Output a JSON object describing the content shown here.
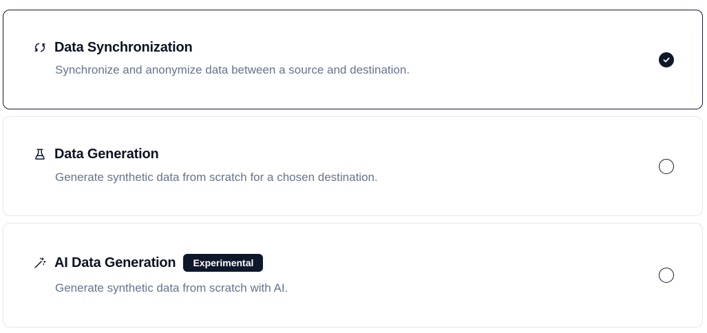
{
  "options": [
    {
      "id": "sync",
      "title": "Data Synchronization",
      "description": "Synchronize and anonymize data between a source and destination.",
      "icon": "sync-arrows-icon",
      "selected": true
    },
    {
      "id": "generation",
      "title": "Data Generation",
      "description": "Generate synthetic data from scratch for a chosen destination.",
      "icon": "flask-icon",
      "selected": false
    },
    {
      "id": "ai-generation",
      "title": "AI Data Generation",
      "badge": "Experimental",
      "description": "Generate synthetic data from scratch with AI.",
      "icon": "magic-wand-icon",
      "selected": false
    }
  ],
  "colors": {
    "accent": "#0f172a",
    "muted_text": "#64748b",
    "border": "#e5e7eb"
  }
}
